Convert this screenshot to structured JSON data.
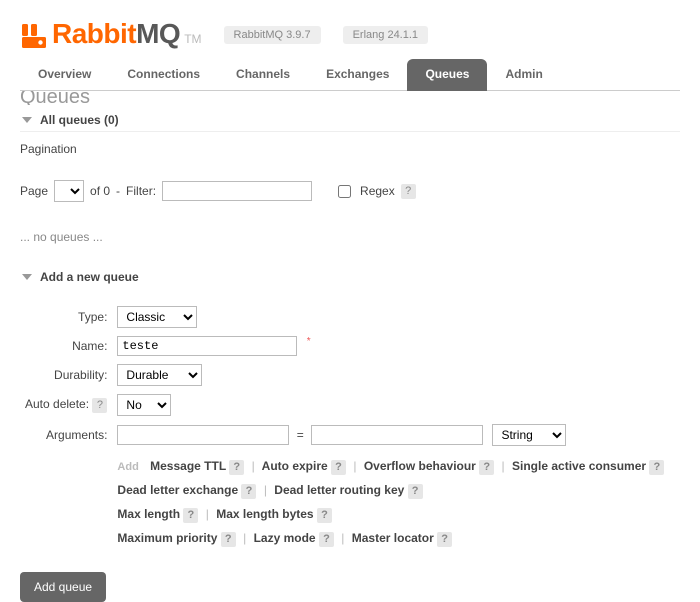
{
  "header": {
    "brand_orange": "Rabbit",
    "brand_gray": "MQ",
    "tm": "TM",
    "version": "RabbitMQ 3.9.7",
    "erlang": "Erlang 24.1.1"
  },
  "tabs": {
    "overview": "Overview",
    "connections": "Connections",
    "channels": "Channels",
    "exchanges": "Exchanges",
    "queues": "Queues",
    "admin": "Admin"
  },
  "cutoff_heading": "Queues",
  "all_queues_title": "All queues (0)",
  "pagination": {
    "heading": "Pagination",
    "page_label": "Page",
    "of_text": "of 0",
    "dash": "-",
    "filter_label": "Filter:",
    "regex_label": "Regex"
  },
  "no_queues": "... no queues ...",
  "add_section_title": "Add a new queue",
  "form": {
    "type_label": "Type:",
    "type_value": "Classic",
    "name_label": "Name:",
    "name_value": "teste",
    "durability_label": "Durability:",
    "durability_value": "Durable",
    "autodelete_label": "Auto delete:",
    "autodelete_value": "No",
    "arguments_label": "Arguments:",
    "eq": "=",
    "argtype_value": "String",
    "add_text": "Add",
    "hints": {
      "ttl": "Message TTL",
      "autoexpire": "Auto expire",
      "overflow": "Overflow behaviour",
      "single": "Single active consumer",
      "dlx": "Dead letter exchange",
      "dlrk": "Dead letter routing key",
      "maxlen": "Max length",
      "maxlenb": "Max length bytes",
      "maxprio": "Maximum priority",
      "lazy": "Lazy mode",
      "master": "Master locator"
    }
  },
  "add_button": "Add queue",
  "help": "?"
}
